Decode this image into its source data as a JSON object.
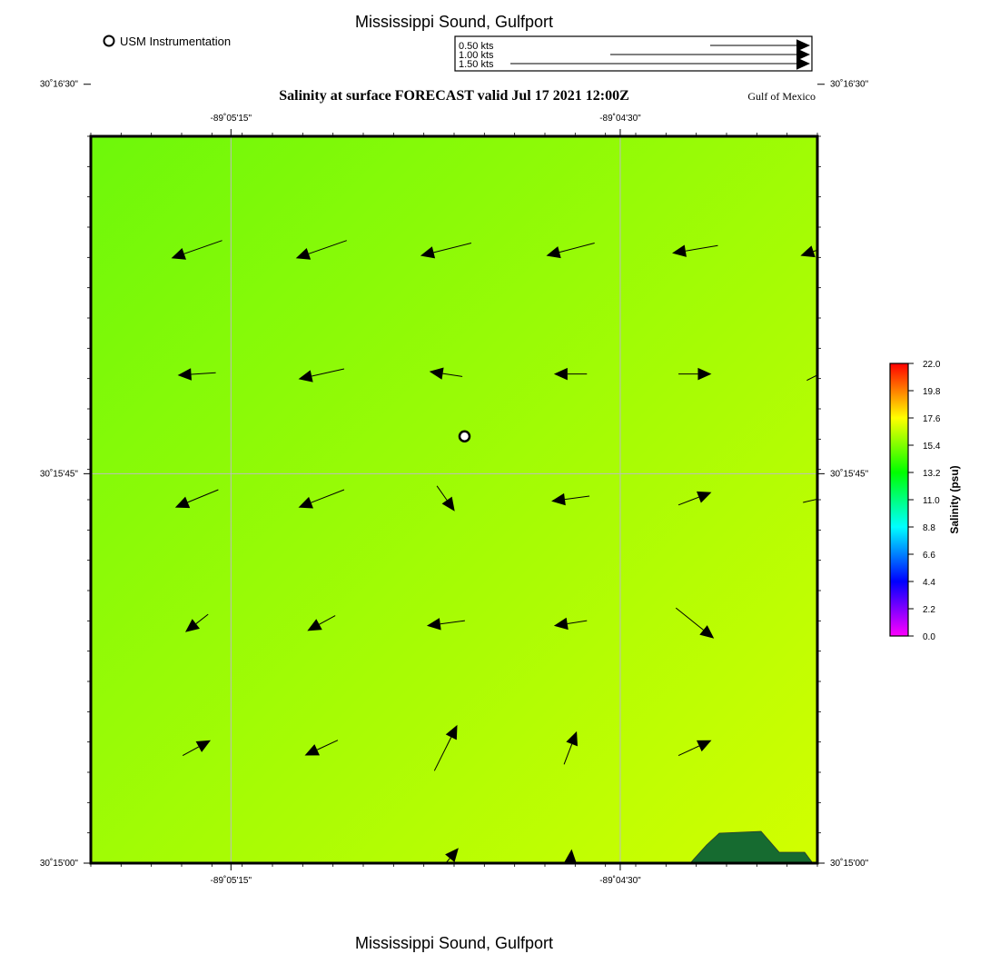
{
  "header": {
    "title": "Mississippi Sound, Gulfport",
    "subtitle": "Salinity at surface FORECAST valid Jul 17 2021 12:00Z",
    "region_label": "Gulf of Mexico",
    "footer_title": "Mississippi Sound, Gulfport"
  },
  "legend": {
    "station_label": "USM Instrumentation",
    "speed_scale": [
      {
        "label": "0.50 kts",
        "speed_kts": 0.5
      },
      {
        "label": "1.00 kts",
        "speed_kts": 1.0
      },
      {
        "label": "1.50 kts",
        "speed_kts": 1.5
      }
    ]
  },
  "map": {
    "lon_range_deg": [
      -89.092,
      -89.06867
    ],
    "lat_range_deg": [
      30.25,
      30.27333
    ],
    "lon_tick_labels": [
      {
        "label": "-89˚05'15\"",
        "lon": -89.0875
      },
      {
        "label": "-89˚04'30\"",
        "lon": -89.075
      }
    ],
    "lat_tick_labels": [
      {
        "label": "30˚16'30\"",
        "lat": 30.275
      },
      {
        "label": "30˚15'45\"",
        "lat": 30.2625
      },
      {
        "label": "30˚15'00\"",
        "lat": 30.25
      }
    ],
    "field_colors": {
      "northwest": "#6df80a",
      "southeast": "#d2ff00",
      "land": "#166b30"
    },
    "station": {
      "name": "USM Instrumentation",
      "lon": -89.08,
      "lat": 30.2637
    }
  },
  "colorbar": {
    "label": "Salinity (psu)",
    "min": 0.0,
    "max": 22.0,
    "tick_labels": [
      "22.0",
      "19.8",
      "17.6",
      "15.4",
      "13.2",
      "11.0",
      "8.8",
      "6.6",
      "4.4",
      "2.2",
      "0.0"
    ],
    "colors": [
      "#ff00ff",
      "#8000ff",
      "#0000ff",
      "#0080ff",
      "#00ffff",
      "#00ff80",
      "#00ff00",
      "#80ff00",
      "#ffff00",
      "#ff8000",
      "#ff0000"
    ]
  },
  "currents": {
    "units": "kts",
    "vectors": [
      {
        "lon": -89.0886,
        "lat": 30.2737,
        "u": -0.36,
        "v": -0.1
      },
      {
        "lon": -89.0846,
        "lat": 30.2737,
        "u": -0.36,
        "v": -0.1
      },
      {
        "lon": -89.0806,
        "lat": 30.2737,
        "u": -0.34,
        "v": -0.05
      },
      {
        "lon": -89.0766,
        "lat": 30.2737,
        "u": -0.36,
        "v": -0.05
      },
      {
        "lon": -89.0726,
        "lat": 30.2737,
        "u": -0.34,
        "v": -0.06
      },
      {
        "lon": -89.0686,
        "lat": 30.2737,
        "u": -0.26,
        "v": -0.1
      },
      {
        "lon": -89.0886,
        "lat": 30.2697,
        "u": -0.4,
        "v": -0.14
      },
      {
        "lon": -89.0846,
        "lat": 30.2697,
        "u": -0.4,
        "v": -0.14
      },
      {
        "lon": -89.0806,
        "lat": 30.2697,
        "u": -0.4,
        "v": -0.1
      },
      {
        "lon": -89.0766,
        "lat": 30.2697,
        "u": -0.38,
        "v": -0.1
      },
      {
        "lon": -89.0726,
        "lat": 30.2697,
        "u": -0.36,
        "v": -0.06
      },
      {
        "lon": -89.0686,
        "lat": 30.2697,
        "u": -0.3,
        "v": -0.1
      },
      {
        "lon": -89.0886,
        "lat": 30.2657,
        "u": -0.3,
        "v": -0.02
      },
      {
        "lon": -89.0846,
        "lat": 30.2657,
        "u": -0.36,
        "v": -0.08
      },
      {
        "lon": -89.0806,
        "lat": 30.2657,
        "u": -0.26,
        "v": 0.04
      },
      {
        "lon": -89.0766,
        "lat": 30.2657,
        "u": -0.26,
        "v": 0.0
      },
      {
        "lon": -89.0726,
        "lat": 30.2657,
        "u": 0.26,
        "v": 0.0
      },
      {
        "lon": -89.0686,
        "lat": 30.2657,
        "u": 0.2,
        "v": 0.1
      },
      {
        "lon": -89.0886,
        "lat": 30.2617,
        "u": -0.34,
        "v": -0.14
      },
      {
        "lon": -89.0846,
        "lat": 30.2617,
        "u": -0.36,
        "v": -0.14
      },
      {
        "lon": -89.0806,
        "lat": 30.2617,
        "u": 0.14,
        "v": -0.2
      },
      {
        "lon": -89.0766,
        "lat": 30.2617,
        "u": -0.3,
        "v": -0.04
      },
      {
        "lon": -89.0726,
        "lat": 30.2617,
        "u": 0.26,
        "v": 0.1
      },
      {
        "lon": -89.0686,
        "lat": 30.2617,
        "u": 0.26,
        "v": 0.06
      },
      {
        "lon": -89.0886,
        "lat": 30.2577,
        "u": -0.18,
        "v": -0.14
      },
      {
        "lon": -89.0846,
        "lat": 30.2577,
        "u": -0.22,
        "v": -0.12
      },
      {
        "lon": -89.0806,
        "lat": 30.2577,
        "u": -0.3,
        "v": -0.04
      },
      {
        "lon": -89.0766,
        "lat": 30.2577,
        "u": -0.26,
        "v": -0.04
      },
      {
        "lon": -89.0726,
        "lat": 30.2577,
        "u": 0.3,
        "v": -0.24
      },
      {
        "lon": -89.0886,
        "lat": 30.2537,
        "u": 0.22,
        "v": 0.12
      },
      {
        "lon": -89.0846,
        "lat": 30.2537,
        "u": -0.26,
        "v": -0.12
      },
      {
        "lon": -89.0806,
        "lat": 30.2537,
        "u": 0.18,
        "v": 0.36
      },
      {
        "lon": -89.0766,
        "lat": 30.2537,
        "u": 0.1,
        "v": 0.26
      },
      {
        "lon": -89.0726,
        "lat": 30.2537,
        "u": 0.26,
        "v": 0.12
      },
      {
        "lon": -89.0806,
        "lat": 30.25,
        "u": 0.2,
        "v": 0.24
      },
      {
        "lon": -89.0766,
        "lat": 30.25,
        "u": 0.02,
        "v": 0.22
      }
    ]
  }
}
